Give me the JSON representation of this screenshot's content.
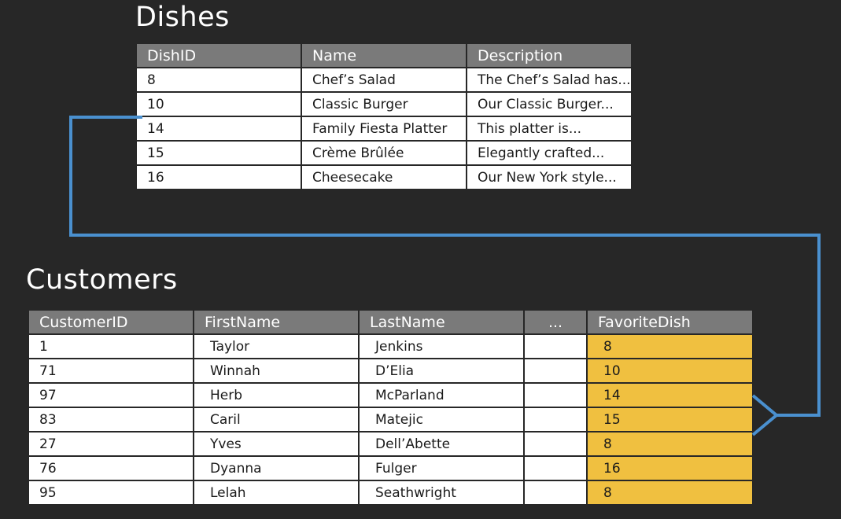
{
  "dishes": {
    "title": "Dishes",
    "columns": [
      "DishID",
      "Name",
      "Description"
    ],
    "rows": [
      [
        "8",
        "Chef’s Salad",
        "The Chef’s Salad has..."
      ],
      [
        "10",
        "Classic Burger",
        "Our Classic Burger..."
      ],
      [
        "14",
        "Family Fiesta Platter",
        "This platter is..."
      ],
      [
        "15",
        "Crème Brûlée",
        "Elegantly crafted..."
      ],
      [
        "16",
        "Cheesecake",
        "Our New York style..."
      ]
    ]
  },
  "customers": {
    "title": "Customers",
    "columns": [
      "CustomerID",
      "FirstName",
      "LastName",
      "...",
      "FavoriteDish"
    ],
    "rows": [
      [
        "1",
        "Taylor",
        "Jenkins",
        "",
        "8"
      ],
      [
        "71",
        "Winnah",
        "D’Elia",
        "",
        "10"
      ],
      [
        "97",
        "Herb",
        "McParland",
        "",
        "14"
      ],
      [
        "83",
        "Caril",
        "Matejic",
        "",
        "15"
      ],
      [
        "27",
        "Yves",
        "Dell’Abette",
        "",
        "8"
      ],
      [
        "76",
        "Dyanna",
        "Fulger",
        "",
        "16"
      ],
      [
        "95",
        "Lelah",
        "Seathwright",
        "",
        "8"
      ]
    ]
  },
  "colors": {
    "background": "#272727",
    "header": "#7a7a7a",
    "highlight": "#f0c040",
    "connector": "#4a90cf"
  }
}
